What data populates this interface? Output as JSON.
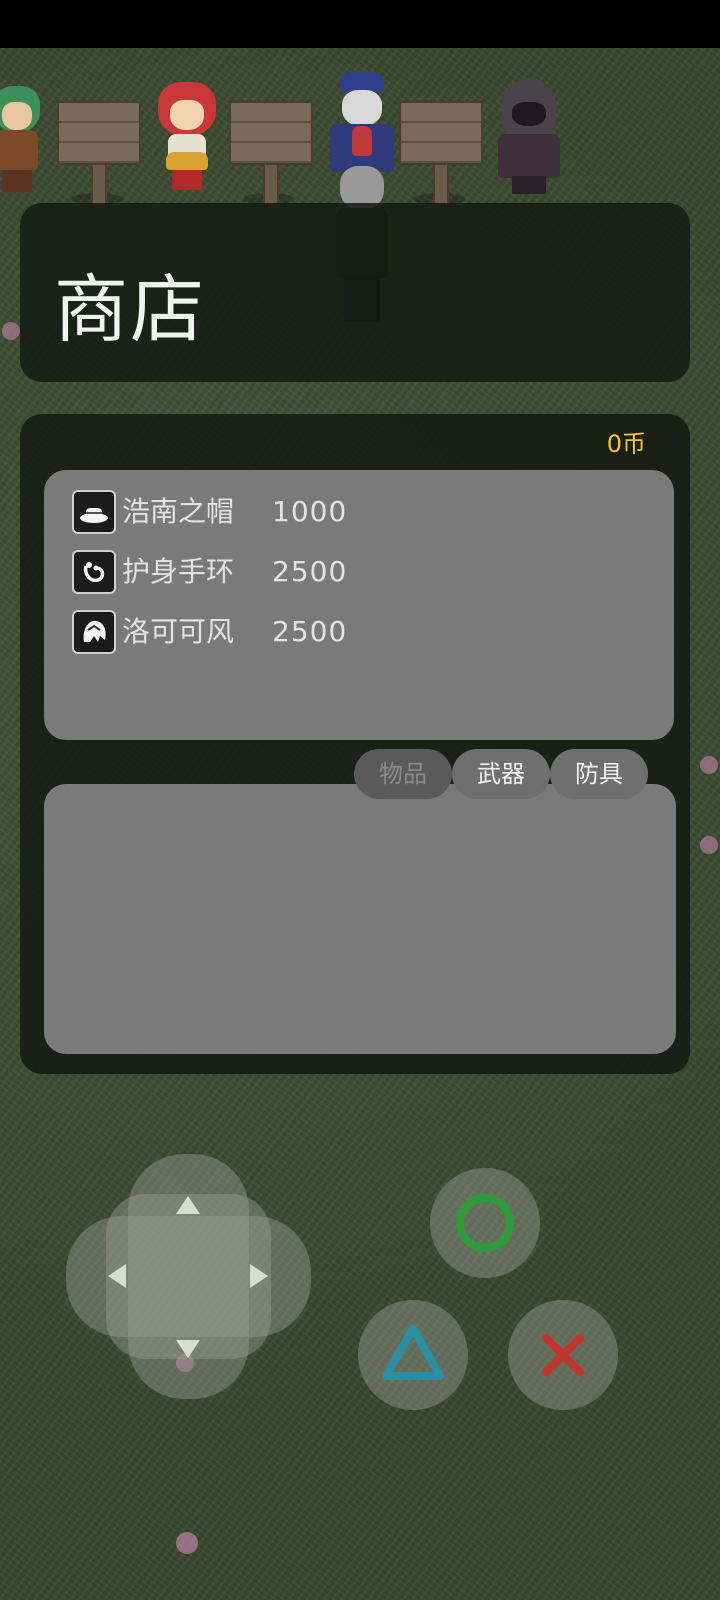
{
  "title": "商店",
  "coins": "0币",
  "items": [
    {
      "name": "浩南之帽",
      "price": "1000",
      "icon": "hat-icon"
    },
    {
      "name": "护身手环",
      "price": "2500",
      "icon": "bracelet-icon"
    },
    {
      "name": "洛可可风",
      "price": "2500",
      "icon": "rococo-icon"
    }
  ],
  "tabs": [
    {
      "label": "物品",
      "active": true
    },
    {
      "label": "武器",
      "active": false
    },
    {
      "label": "防具",
      "active": false
    }
  ],
  "controls": {
    "dpad": [
      "up-arrow-icon",
      "down-arrow-icon",
      "left-arrow-icon",
      "right-arrow-icon"
    ],
    "buttons": [
      "circle-icon",
      "triangle-icon",
      "cross-icon"
    ]
  },
  "colors": {
    "coin": "#f2c230",
    "circle": "#2e9a3a",
    "triangle": "#2a8fa0",
    "cross": "#c0362c"
  }
}
